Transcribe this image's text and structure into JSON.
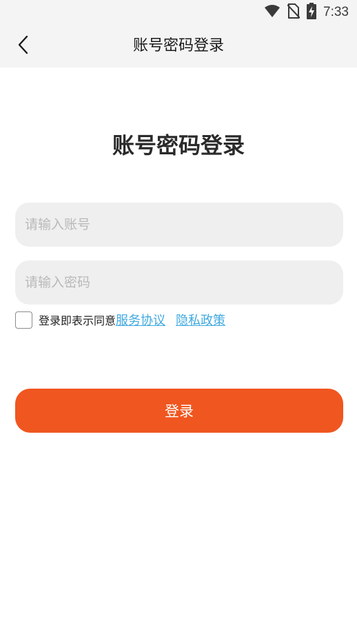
{
  "status_bar": {
    "time": "7:33",
    "icons": [
      "wifi-icon",
      "no-sim-icon",
      "battery-charging-icon"
    ]
  },
  "app_bar": {
    "back_icon": "chevron-left-icon",
    "title": "账号密码登录"
  },
  "main": {
    "heading": "账号密码登录",
    "account_input": {
      "placeholder": "请输入账号",
      "value": ""
    },
    "password_input": {
      "placeholder": "请输入密码",
      "value": ""
    },
    "agreement": {
      "checked": false,
      "prefix": "登录即表示同意",
      "service_link": "服务协议",
      "privacy_link": "隐私政策"
    },
    "login_button": "登录"
  },
  "colors": {
    "primary": "#f0561f",
    "link": "#3fa9e0",
    "header_bg": "#f4f4f4",
    "input_bg": "#efefef"
  }
}
